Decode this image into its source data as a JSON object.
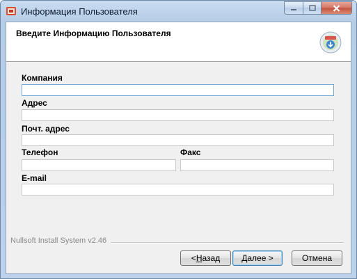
{
  "window": {
    "title": "Информация Пользователя"
  },
  "header": {
    "title": "Введите Информацию Пользователя",
    "icon": "installer-cd-icon"
  },
  "form": {
    "company_label": "Компания",
    "company_value": "",
    "address_label": "Адрес",
    "address_value": "",
    "postal_label": "Почт. адрес",
    "postal_value": "",
    "phone_label": "Телефон",
    "phone_value": "",
    "fax_label": "Факс",
    "fax_value": "",
    "email_label": "E-mail",
    "email_value": ""
  },
  "footer": {
    "brand": "Nullsoft Install System v2.46",
    "back_prefix": "< ",
    "back_mnemonic": "Н",
    "back_rest": "азад",
    "next_mnemonic": "Д",
    "next_rest": "алее >",
    "cancel_label": "Отмена"
  },
  "colors": {
    "focus_border": "#7aa6cf",
    "default_button_border": "#3c7fb1"
  }
}
